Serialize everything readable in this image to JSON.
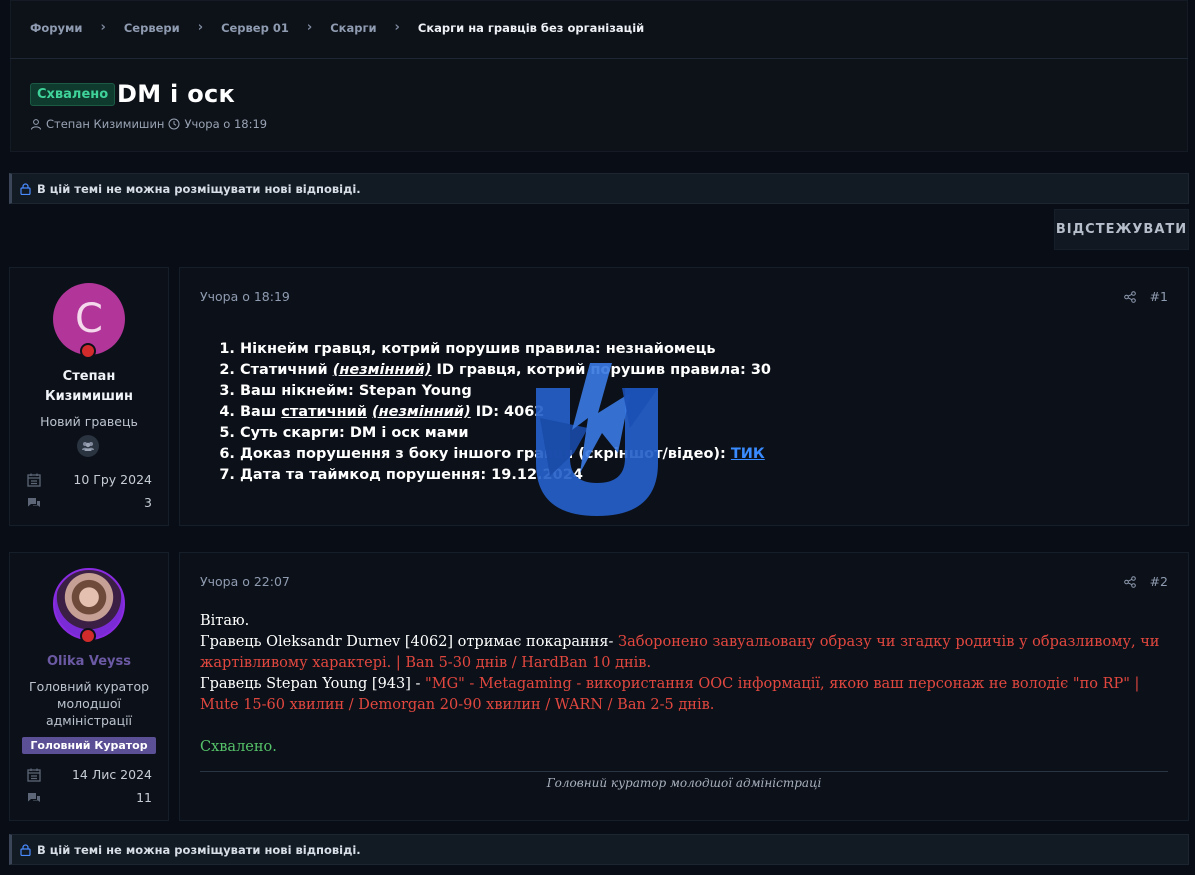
{
  "breadcrumb": {
    "items": [
      "Форуми",
      "Сервери",
      "Сервер 01",
      "Скарги"
    ],
    "current": "Скарги на гравців без організацій"
  },
  "thread": {
    "status_badge": "Схвалено",
    "title": "DM і оск",
    "author": "Степан Кизимишин",
    "time": "Учора о 18:19"
  },
  "notice": {
    "text": "В цій темі не можна розміщувати нові відповіді."
  },
  "follow_button": "ВІДСТЕЖУВАТИ",
  "posts": [
    {
      "user": {
        "avatar_letter": "С",
        "name_line1": "Степан",
        "name_line2": "Кизимишин",
        "role": "Новий гравець",
        "joined": "10 Гру 2024",
        "messages": "3"
      },
      "date": "Учора о 18:19",
      "number": "#1",
      "report": {
        "l1": "Нікнейм гравця, котрий порушив правила: незнайомець",
        "l2_a": "Статичний ",
        "l2_b": "(незмінний)",
        "l2_c": " ID гравця, котрий порушив правила: 30",
        "l3": "Ваш нікнейм: Stepan Young",
        "l4_a": "Ваш ",
        "l4_b": "статичний",
        "l4_c": " ",
        "l4_d": "(незмінний)",
        "l4_e": " ID: 4062",
        "l5": "Суть скарги: DM і оск мами",
        "l6_a": "Доказ порушення з боку іншого гравця (скріншот/відео): ",
        "l6_link": "ТИК",
        "l7": "Дата та таймкод порушення: 19.12.2024"
      }
    },
    {
      "user": {
        "name": "Olika Veyss",
        "role_line1": "Головний куратор",
        "role_line2": "молодшої",
        "role_line3": "адміністрації",
        "role_tag": "Головний Куратор",
        "joined": "14 Лис 2024",
        "messages": "11"
      },
      "date": "Учора о 22:07",
      "number": "#2",
      "reply": {
        "greeting": "Вітаю.",
        "p1_a": "Гравець Oleksandr Durnev [4062] отримає покарання- ",
        "p1_b": "Заборонено завуальовану образу чи згадку родичів у образливому, чи жартівливому характері. | Ban 5-30 днів / HardBan 10 днів.",
        "p2_a": "Гравець Stepan Young [943] - ",
        "p2_b": "\"MG\" - Metagaming - використання OOC інформації, якою ваш персонаж не володіє \"по RP\" | Mute 15-60 хвилин / Demorgan 20-90 хвилин / WARN / Ban 2-5 днів.",
        "approved": "Схвалено."
      },
      "signature": "Головний куратор молодшої адміністраці"
    }
  ],
  "colors": {
    "background": "#090e16",
    "card": "#0c1119",
    "approved_badge": "#3fd39a",
    "red_text": "#e2473f",
    "green_text": "#56c26a",
    "link": "#3a8bff",
    "role_tag": "#5b4f95",
    "watermark": "#2560c8"
  },
  "icons": [
    "user-icon",
    "clock-icon",
    "lock-icon",
    "share-icon",
    "calendar-icon",
    "messages-icon",
    "group-icon",
    "status-dot-icon",
    "watermark-logo"
  ]
}
